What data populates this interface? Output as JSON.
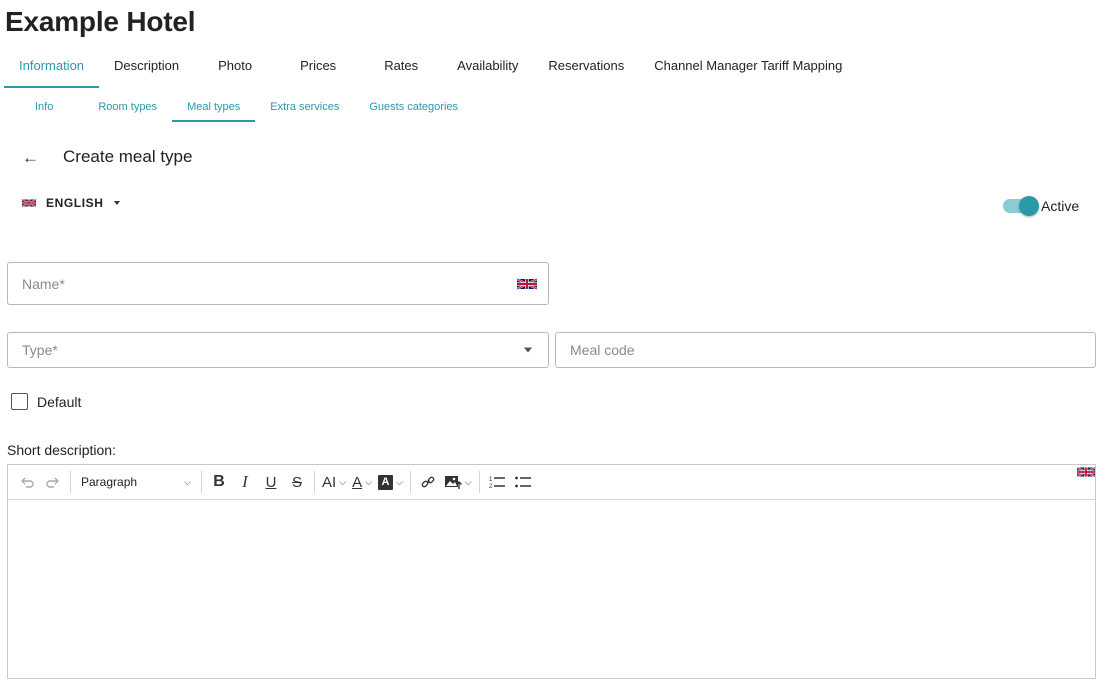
{
  "hotel": {
    "title": "Example Hotel"
  },
  "main_tabs": [
    {
      "label": "Information",
      "active": true
    },
    {
      "label": "Description"
    },
    {
      "label": "Photo"
    },
    {
      "label": "Prices"
    },
    {
      "label": "Rates"
    },
    {
      "label": "Availability"
    },
    {
      "label": "Reservations"
    },
    {
      "label": "Channel Manager Tariff Mapping"
    }
  ],
  "sub_tabs": [
    {
      "label": "Info"
    },
    {
      "label": "Room types"
    },
    {
      "label": "Meal types",
      "active": true
    },
    {
      "label": "Extra services"
    },
    {
      "label": "Guests categories"
    }
  ],
  "page": {
    "back_icon": "arrow-left-icon",
    "title": "Create meal type"
  },
  "language": {
    "flag_icon": "uk-flag-icon",
    "label": "ENGLISH"
  },
  "active_toggle": {
    "label": "Active",
    "on": true,
    "color": "#2b9aa8"
  },
  "form": {
    "name_placeholder": "Name*",
    "type_placeholder": "Type*",
    "meal_code_placeholder": "Meal code",
    "default_label": "Default",
    "default_checked": false,
    "short_description_label": "Short description:"
  },
  "editor": {
    "paragraph_label": "Paragraph",
    "tools": [
      "undo-icon",
      "redo-icon",
      "bold-icon",
      "italic-icon",
      "underline-icon",
      "strikethrough-icon",
      "font-size-icon",
      "font-color-icon",
      "highlight-icon",
      "link-icon",
      "insert-image-icon",
      "numbered-list-icon",
      "bulleted-list-icon"
    ]
  },
  "accent_color": "#2b9aa8"
}
